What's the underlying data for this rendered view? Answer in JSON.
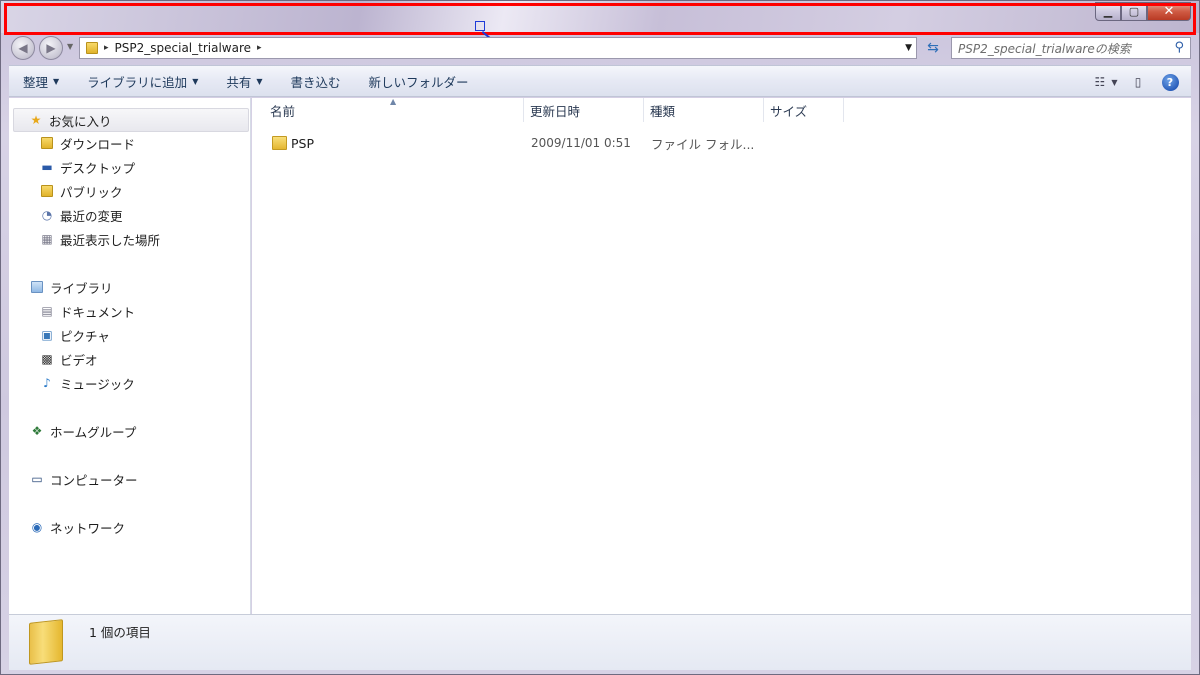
{
  "window": {
    "caption": {
      "minimize": "▁",
      "maximize": "▢",
      "close": "✕"
    }
  },
  "address": {
    "path": [
      "PSP2_special_trialware"
    ],
    "sep": "▸"
  },
  "search": {
    "placeholder": "PSP2_special_trialwareの検索"
  },
  "toolbar": {
    "organize": "整理",
    "add_to_library": "ライブラリに追加",
    "share": "共有",
    "burn": "書き込む",
    "new_folder": "新しいフォルダー",
    "help": "?"
  },
  "nav": {
    "favorites": "お気に入り",
    "downloads": "ダウンロード",
    "desktop": "デスクトップ",
    "public": "パブリック",
    "recent_changes": "最近の変更",
    "recent_places": "最近表示した場所",
    "libraries": "ライブラリ",
    "documents": "ドキュメント",
    "pictures": "ピクチャ",
    "videos": "ビデオ",
    "music": "ミュージック",
    "homegroup": "ホームグループ",
    "computer": "コンピューター",
    "network": "ネットワーク"
  },
  "columns": {
    "name": "名前",
    "date": "更新日時",
    "type": "種類",
    "size": "サイズ"
  },
  "files": [
    {
      "name": "PSP",
      "date": "2009/11/01 0:51",
      "type": "ファイル フォル...",
      "size": ""
    }
  ],
  "status": {
    "item_count": "1 個の項目"
  }
}
